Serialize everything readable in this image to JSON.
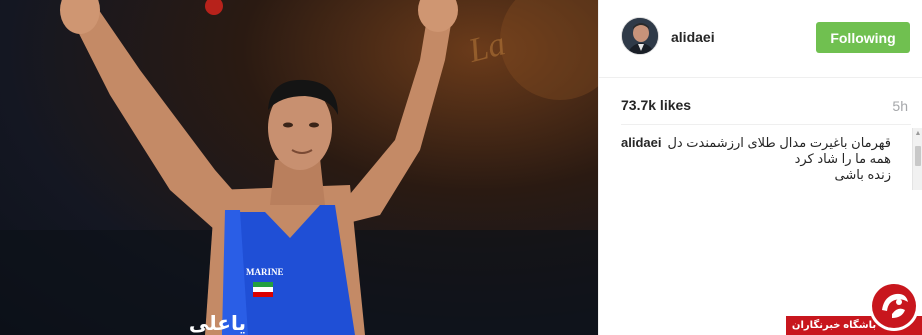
{
  "post": {
    "username": "alidaei",
    "follow_label": "Following",
    "likes": "73.7k likes",
    "time": "5h",
    "caption": {
      "user": "alidaei",
      "line1": "قهرمان باغیرت مدال طلای ارزشمندت دل",
      "line2": "همه ما را شاد کرد",
      "line3": "زنده باشی"
    }
  },
  "photo": {
    "singlet_text": "MARINE",
    "singlet_name": "یاعلی"
  },
  "watermark": {
    "text": "باشگاه خبرنگاران"
  },
  "colors": {
    "follow_button": "#70c050",
    "watermark_red": "#c8161d",
    "singlet_blue": "#1f4fd6"
  },
  "icons": {
    "scroll_up": "scroll-up-arrow-icon",
    "watermark": "club-logo-icon"
  }
}
